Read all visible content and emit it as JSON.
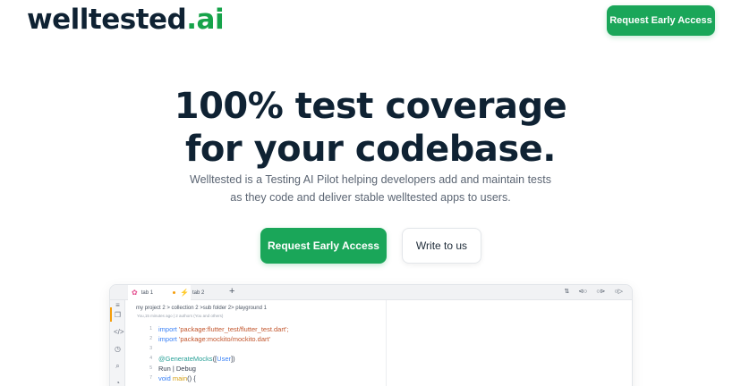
{
  "header": {
    "logo_main": "welltested",
    "logo_tld": ".ai",
    "cta": "Request Early Access"
  },
  "hero": {
    "title_line1": "100% test coverage",
    "title_line2": "for your codebase.",
    "subtitle": "Welltested is a Testing AI Pilot helping developers add and maintain tests as they code and deliver stable welltested apps to users.",
    "primary_cta": "Request Early Access",
    "secondary_cta": "Write to us"
  },
  "editor": {
    "tabs": [
      {
        "label": "tab 1",
        "icon": "file-pink-icon"
      },
      {
        "label": "tab 2",
        "icon": "flutter-bolt-icon"
      }
    ],
    "add_tab": "+",
    "breadcrumb": "my project 2 > collection 2 >sub folder 2> playground 1",
    "blame": "You,15 minutes ago | 2 authors (You and others)",
    "lines": [
      {
        "n": "1",
        "kw": "import",
        "str": "'package:flutter_test/flutter_test.dart';"
      },
      {
        "n": "2",
        "kw": "import",
        "str": "'package:mockito/mockito.dart'"
      },
      {
        "n": "3"
      },
      {
        "n": "4",
        "annotation": "@GenerateMocks",
        "bracket_open": "([",
        "type": "User",
        "bracket_close": "])"
      },
      {
        "n": "5",
        "text": "Run | Debug"
      },
      {
        "n": "7",
        "kw": "void",
        "fn": "main",
        "tail": "() {"
      }
    ]
  },
  "colors": {
    "brand_green": "#1aa659",
    "ink": "#0f2233"
  }
}
